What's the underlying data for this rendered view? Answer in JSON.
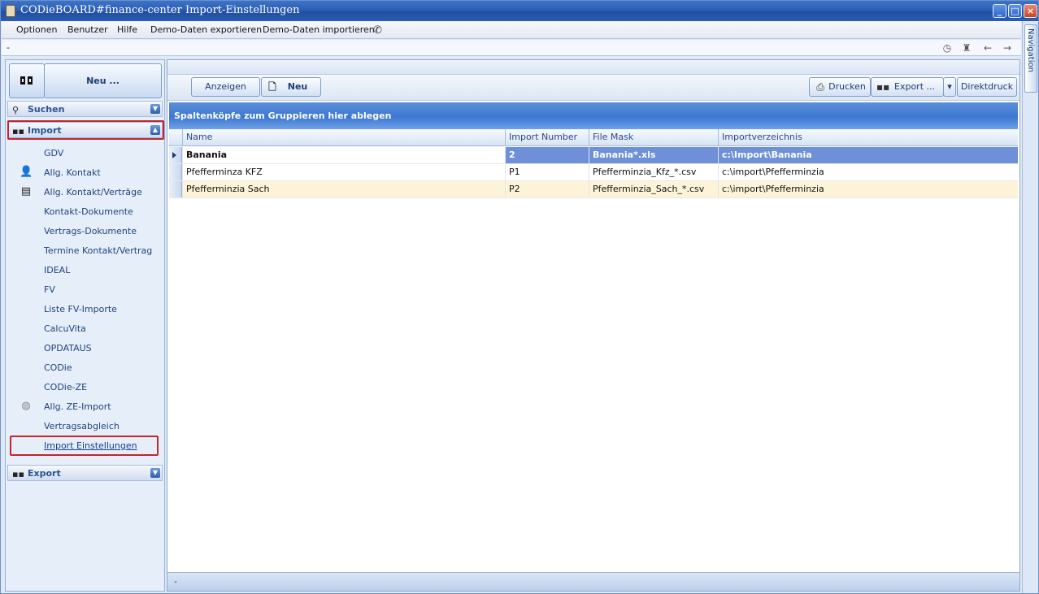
{
  "window": {
    "title": "CODieBOARD#finance-center Import-Einstellungen",
    "controls": {
      "minimize": "_",
      "maximize": "□",
      "close": "×"
    }
  },
  "menubar": {
    "items": [
      "Optionen",
      "Benutzer",
      "Hilfe",
      "Demo-Daten exportieren",
      "Demo-Daten importieren"
    ],
    "phone_icon": "phone-icon"
  },
  "addressbar": {
    "text": "-"
  },
  "navigation_tab": {
    "label": "Navigation"
  },
  "leftpane": {
    "new_button": "Neu ...",
    "sections": {
      "suchen": "Suchen",
      "import": "Import",
      "export": "Export"
    },
    "items": [
      {
        "label": "GDV",
        "icon": ""
      },
      {
        "label": "Allg. Kontakt",
        "icon": "person-icon"
      },
      {
        "label": "Allg. Kontakt/Verträge",
        "icon": "document-icon"
      },
      {
        "label": "Kontakt-Dokumente",
        "icon": ""
      },
      {
        "label": "Vertrags-Dokumente",
        "icon": ""
      },
      {
        "label": "Termine Kontakt/Vertrag",
        "icon": ""
      },
      {
        "label": "IDEAL",
        "icon": ""
      },
      {
        "label": "FV",
        "icon": ""
      },
      {
        "label": "Liste FV-Importe",
        "icon": ""
      },
      {
        "label": "CalcuVita",
        "icon": ""
      },
      {
        "label": "OPDATAUS",
        "icon": ""
      },
      {
        "label": "CODie",
        "icon": ""
      },
      {
        "label": "CODie-ZE",
        "icon": ""
      },
      {
        "label": "Allg. ZE-Import",
        "icon": "disc-icon"
      },
      {
        "label": "Vertragsabgleich",
        "icon": ""
      },
      {
        "label": "Import Einstellungen",
        "icon": ""
      }
    ]
  },
  "toolbar": {
    "anzeigen": "Anzeigen",
    "neu": "Neu",
    "drucken": "Drucken",
    "export": "Export ...",
    "direktdruck": "Direktdruck"
  },
  "grid": {
    "group_hint": "Spaltenköpfe zum Gruppieren hier ablegen",
    "columns": [
      "Name",
      "Import Number",
      "File Mask",
      "Importverzeichnis"
    ],
    "rows": [
      {
        "name": "Banania",
        "number": "2",
        "mask": "Banania*.xls",
        "dir": "c:\\Import\\Banania"
      },
      {
        "name": "Pfefferminza KFZ",
        "number": "P1",
        "mask": "Pfefferminzia_Kfz_*.csv",
        "dir": "c:\\import\\Pfefferminzia"
      },
      {
        "name": "Pfefferminzia Sach",
        "number": "P2",
        "mask": "Pfefferminzia_Sach_*.csv",
        "dir": "c:\\import\\Pfefferminzia"
      }
    ],
    "footer": "-"
  },
  "colors": {
    "title_bar": "#2b5fb5",
    "group_header": "#3d77cf",
    "selected_cell": "#6d90d9",
    "alt_row": "#fdf3d8",
    "highlight_box": "#c0262c"
  }
}
